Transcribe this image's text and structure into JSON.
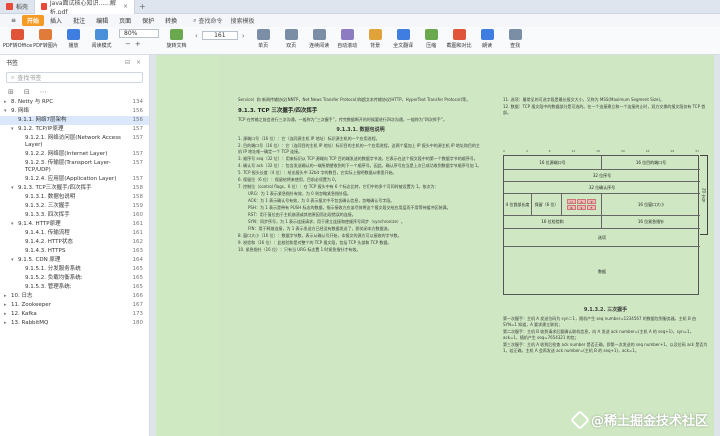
{
  "tabs": [
    {
      "label": "稻壳",
      "color": "#e84a3a"
    },
    {
      "label": "Java面试核心知识......解析.pdf",
      "color": "#e84a3a",
      "close": "×"
    }
  ],
  "menu": {
    "items": [
      "开始",
      "插入",
      "批注",
      "编辑",
      "页面",
      "保护",
      "转换"
    ],
    "active_index": 0,
    "search_label": "查找命令",
    "search_extra": "搜索模板"
  },
  "toolbar": {
    "tools": [
      {
        "label": "PDF转Office",
        "color": "#e0553a"
      },
      {
        "label": "PDF转图片",
        "color": "#e07b3a"
      },
      {
        "label": "播放",
        "color": "#3f7ee0"
      },
      {
        "label": "阅读模式",
        "color": "#4a90d9"
      },
      {
        "label": "旋转文档",
        "color": "#6aa84f"
      },
      {
        "label": "单页",
        "color": "#7a8ea6"
      },
      {
        "label": "双页",
        "color": "#7a8ea6"
      },
      {
        "label": "连续阅读",
        "color": "#7a8ea6"
      },
      {
        "label": "自动滚动",
        "color": "#8e7cc3"
      },
      {
        "label": "背景",
        "color": "#e0a33a"
      },
      {
        "label": "全文翻译",
        "color": "#3f7ee0"
      },
      {
        "label": "压缩",
        "color": "#6aa84f"
      },
      {
        "label": "截图和对比",
        "color": "#e0553a"
      },
      {
        "label": "朗读",
        "color": "#3f7ee0"
      },
      {
        "label": "查找",
        "color": "#7a8ea6"
      }
    ],
    "zoom_value": "80%",
    "zoom_in": "+",
    "zoom_out": "−",
    "page_value": "161",
    "prev": "‹",
    "next": "›"
  },
  "sidebar": {
    "title": "书签",
    "search_placeholder": "查找书签",
    "items": [
      {
        "label": "8. Netty 与 RPC",
        "page": "134",
        "level": 0,
        "caret": "▸"
      },
      {
        "label": "9. 网络",
        "page": "156",
        "level": 0,
        "caret": "▾"
      },
      {
        "label": "9.1.1. 网络7层架构",
        "page": "156",
        "level": 1,
        "caret": "",
        "selected": true
      },
      {
        "label": "9.1.2. TCP/IP原理",
        "page": "157",
        "level": 1,
        "caret": "▾"
      },
      {
        "label": "9.1.2.1. 网络访问层(Network Access Layer)",
        "page": "157",
        "level": 2,
        "caret": ""
      },
      {
        "label": "9.1.2.2. 网络层(Internet Layer)",
        "page": "157",
        "level": 2,
        "caret": ""
      },
      {
        "label": "9.1.2.3. 传输层(Transport Layer-TCP/UDP)",
        "page": "157",
        "level": 2,
        "caret": ""
      },
      {
        "label": "9.1.2.4. 应用层(Application Layer)",
        "page": "157",
        "level": 2,
        "caret": ""
      },
      {
        "label": "9.1.3. TCP三次握手/四次挥手",
        "page": "158",
        "level": 1,
        "caret": "▾"
      },
      {
        "label": "9.1.3.1. 数据包说明",
        "page": "158",
        "level": 2,
        "caret": ""
      },
      {
        "label": "9.1.3.2. 三次握手",
        "page": "159",
        "level": 2,
        "caret": ""
      },
      {
        "label": "9.1.3.3. 四次挥手",
        "page": "160",
        "level": 2,
        "caret": ""
      },
      {
        "label": "9.1.4. HTTP原理",
        "page": "161",
        "level": 1,
        "caret": "▾"
      },
      {
        "label": "9.1.4.1. 传输流程",
        "page": "161",
        "level": 2,
        "caret": ""
      },
      {
        "label": "9.1.4.2. HTTP状态",
        "page": "162",
        "level": 2,
        "caret": ""
      },
      {
        "label": "9.1.4.3. HTTPS",
        "page": "163",
        "level": 2,
        "caret": ""
      },
      {
        "label": "9.1.5. CDN 原理",
        "page": "164",
        "level": 1,
        "caret": "▾"
      },
      {
        "label": "9.1.5.1. 分发服务系统",
        "page": "165",
        "level": 2,
        "caret": ""
      },
      {
        "label": "9.1.5.2. 负载均衡系统:",
        "page": "165",
        "level": 2,
        "caret": ""
      },
      {
        "label": "9.1.5.3. 管理系统:",
        "page": "165",
        "level": 2,
        "caret": ""
      },
      {
        "label": "10. 日志",
        "page": "166",
        "level": 0,
        "caret": "▸"
      },
      {
        "label": "11. Zookeeper",
        "page": "167",
        "level": 0,
        "caret": "▸"
      },
      {
        "label": "12. Kafka",
        "page": "173",
        "level": 0,
        "caret": "▸"
      },
      {
        "label": "13. RabbitMQ",
        "page": "180",
        "level": 0,
        "caret": "▸"
      }
    ]
  },
  "document": {
    "left": {
      "intro": "Service）和 新闻传输协议(NNTP，Net News Transfer Protocol)和超文本传输协议(HTTP，HyperText Transfer Protocol)等。",
      "heading": "9.1.3.  TCP 三次握手/四次挥手",
      "para1": "TCP 在传输之前会进行三次沟通，一般称为“三次握手”，传完数据断开的时候要进行四次沟通，一般称为“四次挥手”。",
      "sub": "9.1.3.1.  数据包说明",
      "items": [
        "1.  源端口号（16 位）：它（连同源主机 IP 地址）标识源主机的一个应用进程。",
        "2.  目的端口号（16 位）：它（连同目的主机 IP 地址）标识目的主机的一个应用进程。这两个值加上 IP 报头中的源主机 IP 地址和目的主机 IP 地址唯一确定一个 TCP 连接。",
        "3.  顺序号 seq（32 位）：用来标识从 TCP 源端向 TCP 目的端发送的数据字节流，它表示在这个报文段中的第一个数据字节的顺序号。",
        "4.  确认号 ack（32 位）：包含发送确认的一端所期望收到的下一个顺序号。因此，确认序号应当是上次已成功收到数据字节顺序号加 1。",
        "5.  TCP 报头长度（4 位）：给出报头中 32bit 字的数目，它实际上指明数据从哪里开始。",
        "6.  保留位（6 位）：保留给将来使用，目前必须置为 0。",
        "7.  控制位（control flags，6 位）：在 TCP 报头中有 6 个标志比特，它们中的多个可同时被设置为 1。依次为：",
        "URG：为 1 表示紧急指针有效，为 0 则忽略紧急指针值。",
        "ACK：为 1 表示确认号有效，为 0 表示报文中不包含确认信息，忽略确认号字段。",
        "PSH：为 1 表示是带有 PUSH 标志的数据，指示接收方应该尽快将这个报文段交给应用层而不用等待缓冲区装满。",
        "RST：用于复位由于主机崩溃或其他原因而出现错误的连接。",
        "SYN：同步序号，为 1 表示连接请求，用于建立连接和使顺序号同步（synchronize）。",
        "FIN：用于释放连接，为 1 表示发送方已经没有数据发送了，即关闭本方数据流。",
        "8.  窗口大小（16 位）：数据字节数，表示从确认号开始，本报文的源方可以接收的字节数。",
        "9.  校验和（16 位）：此校验和是对整个的 TCP 报文段，包括 TCP 头部和 TCP 数据。",
        "10. 紧急指针（16 位）：只有当 URG 标志置 1 时紧急指针才有效。"
      ]
    },
    "right": {
      "items": [
        "11. 选项：最常见的可选字段是最长报文大小，又称为 MSS(Maximum Segment Size)。",
        "12. 数据：TCP 报文段中的数据部分是可选的。在一个连接建立和一个连接终止时，双方交换的报文段仅有 TCP 首部。"
      ],
      "sub": "9.1.3.2.  三次握手",
      "handshake": [
        "第一次握手：主机 A 发送位码为 syn＝1，随机产生 seq number=1234567 的数据包到服务器，主机 B 由 SYN=1 知道，A 要求建立联机；",
        "第二次握手：主机 B 收到请求后要确认联机信息，向 A 发送 ack number=(主机 A 的 seq+1)，syn=1，ack=1，随机产生 seq=7654321 的包；",
        "第三次握手：主机 A 收到后检查 ack number 是否正确，即第一次发送的 seq number+1，以及位码 ack 是否为 1，若正确，主机 A 会再发送 ack number=(主机 B 的 seq+1)，ack=1。"
      ]
    },
    "diagram": {
      "ruler": [
        "0",
        "4",
        "8",
        "12",
        "16",
        "20",
        "24",
        "28",
        "31"
      ],
      "src_port": "16 位源端口号",
      "dst_port": "16 位目的端口号",
      "seq": "32 位序号",
      "ack": "32 位确认序号",
      "hdr_len": "4 位首部长度",
      "reserved": "保留（6 位）",
      "flags": [
        "U",
        "A",
        "P",
        "R",
        "S",
        "F"
      ],
      "window": "16 位窗口大小",
      "checksum": "16 位检验和",
      "urgent": "16 位紧急指针",
      "options": "选项",
      "data": "数据",
      "side": "20 字节"
    }
  },
  "watermark": "@稀土掘金技术社区"
}
